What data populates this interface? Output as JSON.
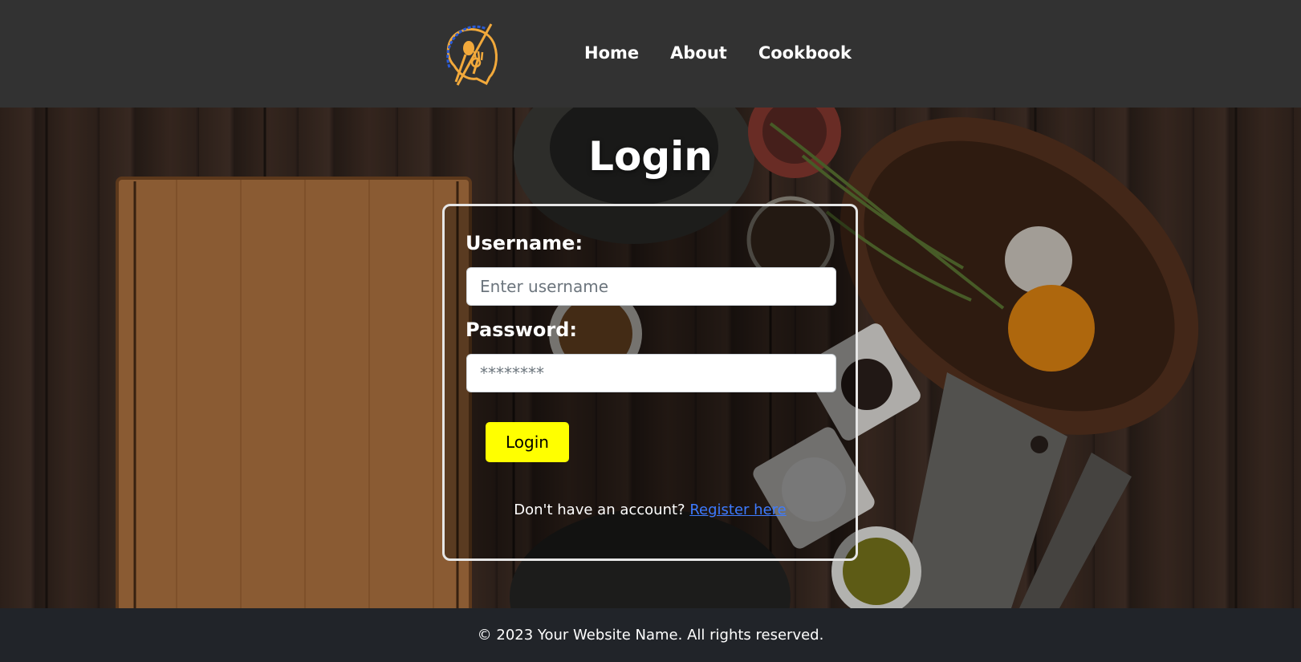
{
  "nav": {
    "logo_icon": "chat-bubble-spoon-fork-logo",
    "links": [
      {
        "label": "Home"
      },
      {
        "label": "About"
      },
      {
        "label": "Cookbook"
      }
    ]
  },
  "login": {
    "title": "Login",
    "username_label": "Username:",
    "username_placeholder": "Enter username",
    "password_label": "Password:",
    "password_placeholder": "********",
    "button_label": "Login",
    "register_prompt": "Don't have an account?",
    "register_link": "Register here"
  },
  "footer": {
    "text": "© 2023 Your Website Name. All rights reserved."
  },
  "colors": {
    "navbar_bg": "#323232",
    "button_accent": "#ffff00",
    "link": "#3d7bff",
    "footer_bg": "#212429",
    "logo_orange": "#f2a93b",
    "logo_blue": "#2a5bd7"
  }
}
